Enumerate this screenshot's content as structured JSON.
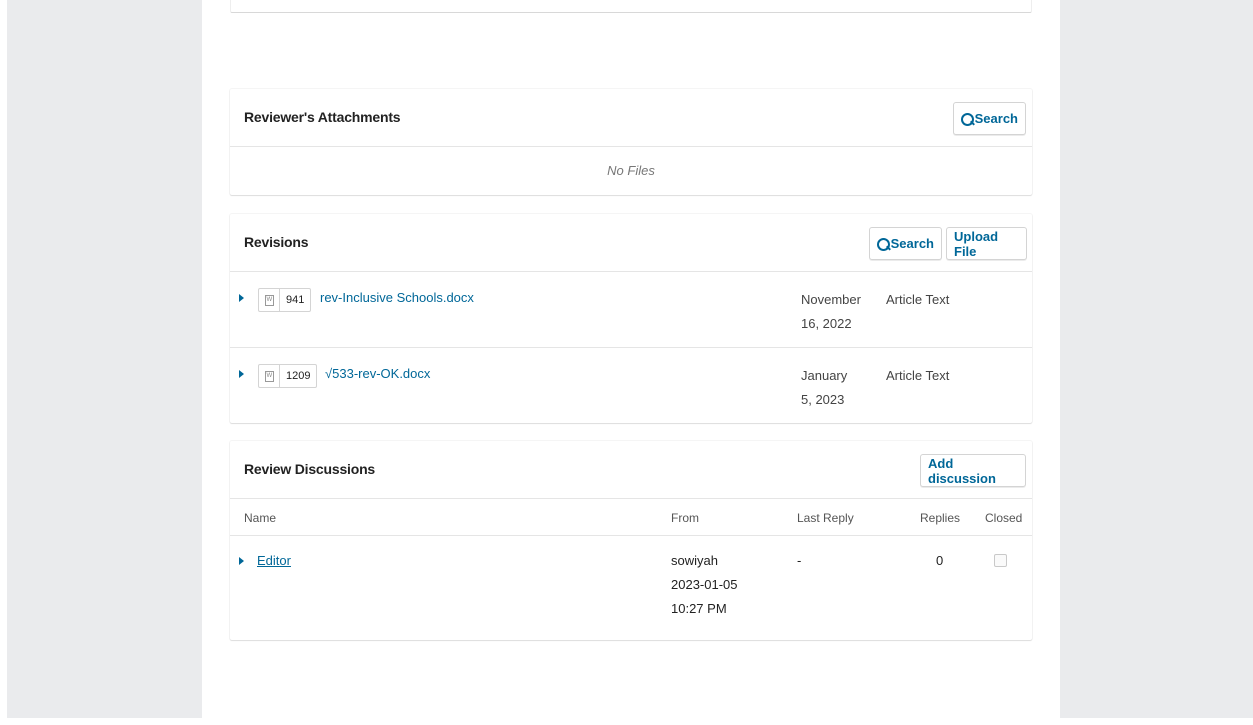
{
  "attachments": {
    "title": "Reviewer's Attachments",
    "search_label": "Search",
    "empty_text": "No Files"
  },
  "revisions": {
    "title": "Revisions",
    "search_label": "Search",
    "upload_label": "Upload File",
    "files": [
      {
        "id": "941",
        "name": "rev-Inclusive Schools.docx",
        "date_line1": "November",
        "date_line2": "16, 2022",
        "type": "Article Text"
      },
      {
        "id": "1209",
        "name": "√533-rev-OK.docx",
        "date_line1": "January",
        "date_line2": "5, 2023",
        "type": "Article Text"
      }
    ]
  },
  "discussions": {
    "title": "Review Discussions",
    "add_label": "Add discussion",
    "columns": {
      "name": "Name",
      "from": "From",
      "last_reply": "Last Reply",
      "replies": "Replies",
      "closed": "Closed"
    },
    "rows": [
      {
        "name": "Editor",
        "from_user": "sowiyah",
        "from_date": "2023-01-05",
        "from_time": "10:27 PM",
        "last_reply": "-",
        "replies": "0",
        "closed": false
      }
    ]
  },
  "colors": {
    "accent": "#006798",
    "page_bg": "#eaebed"
  }
}
